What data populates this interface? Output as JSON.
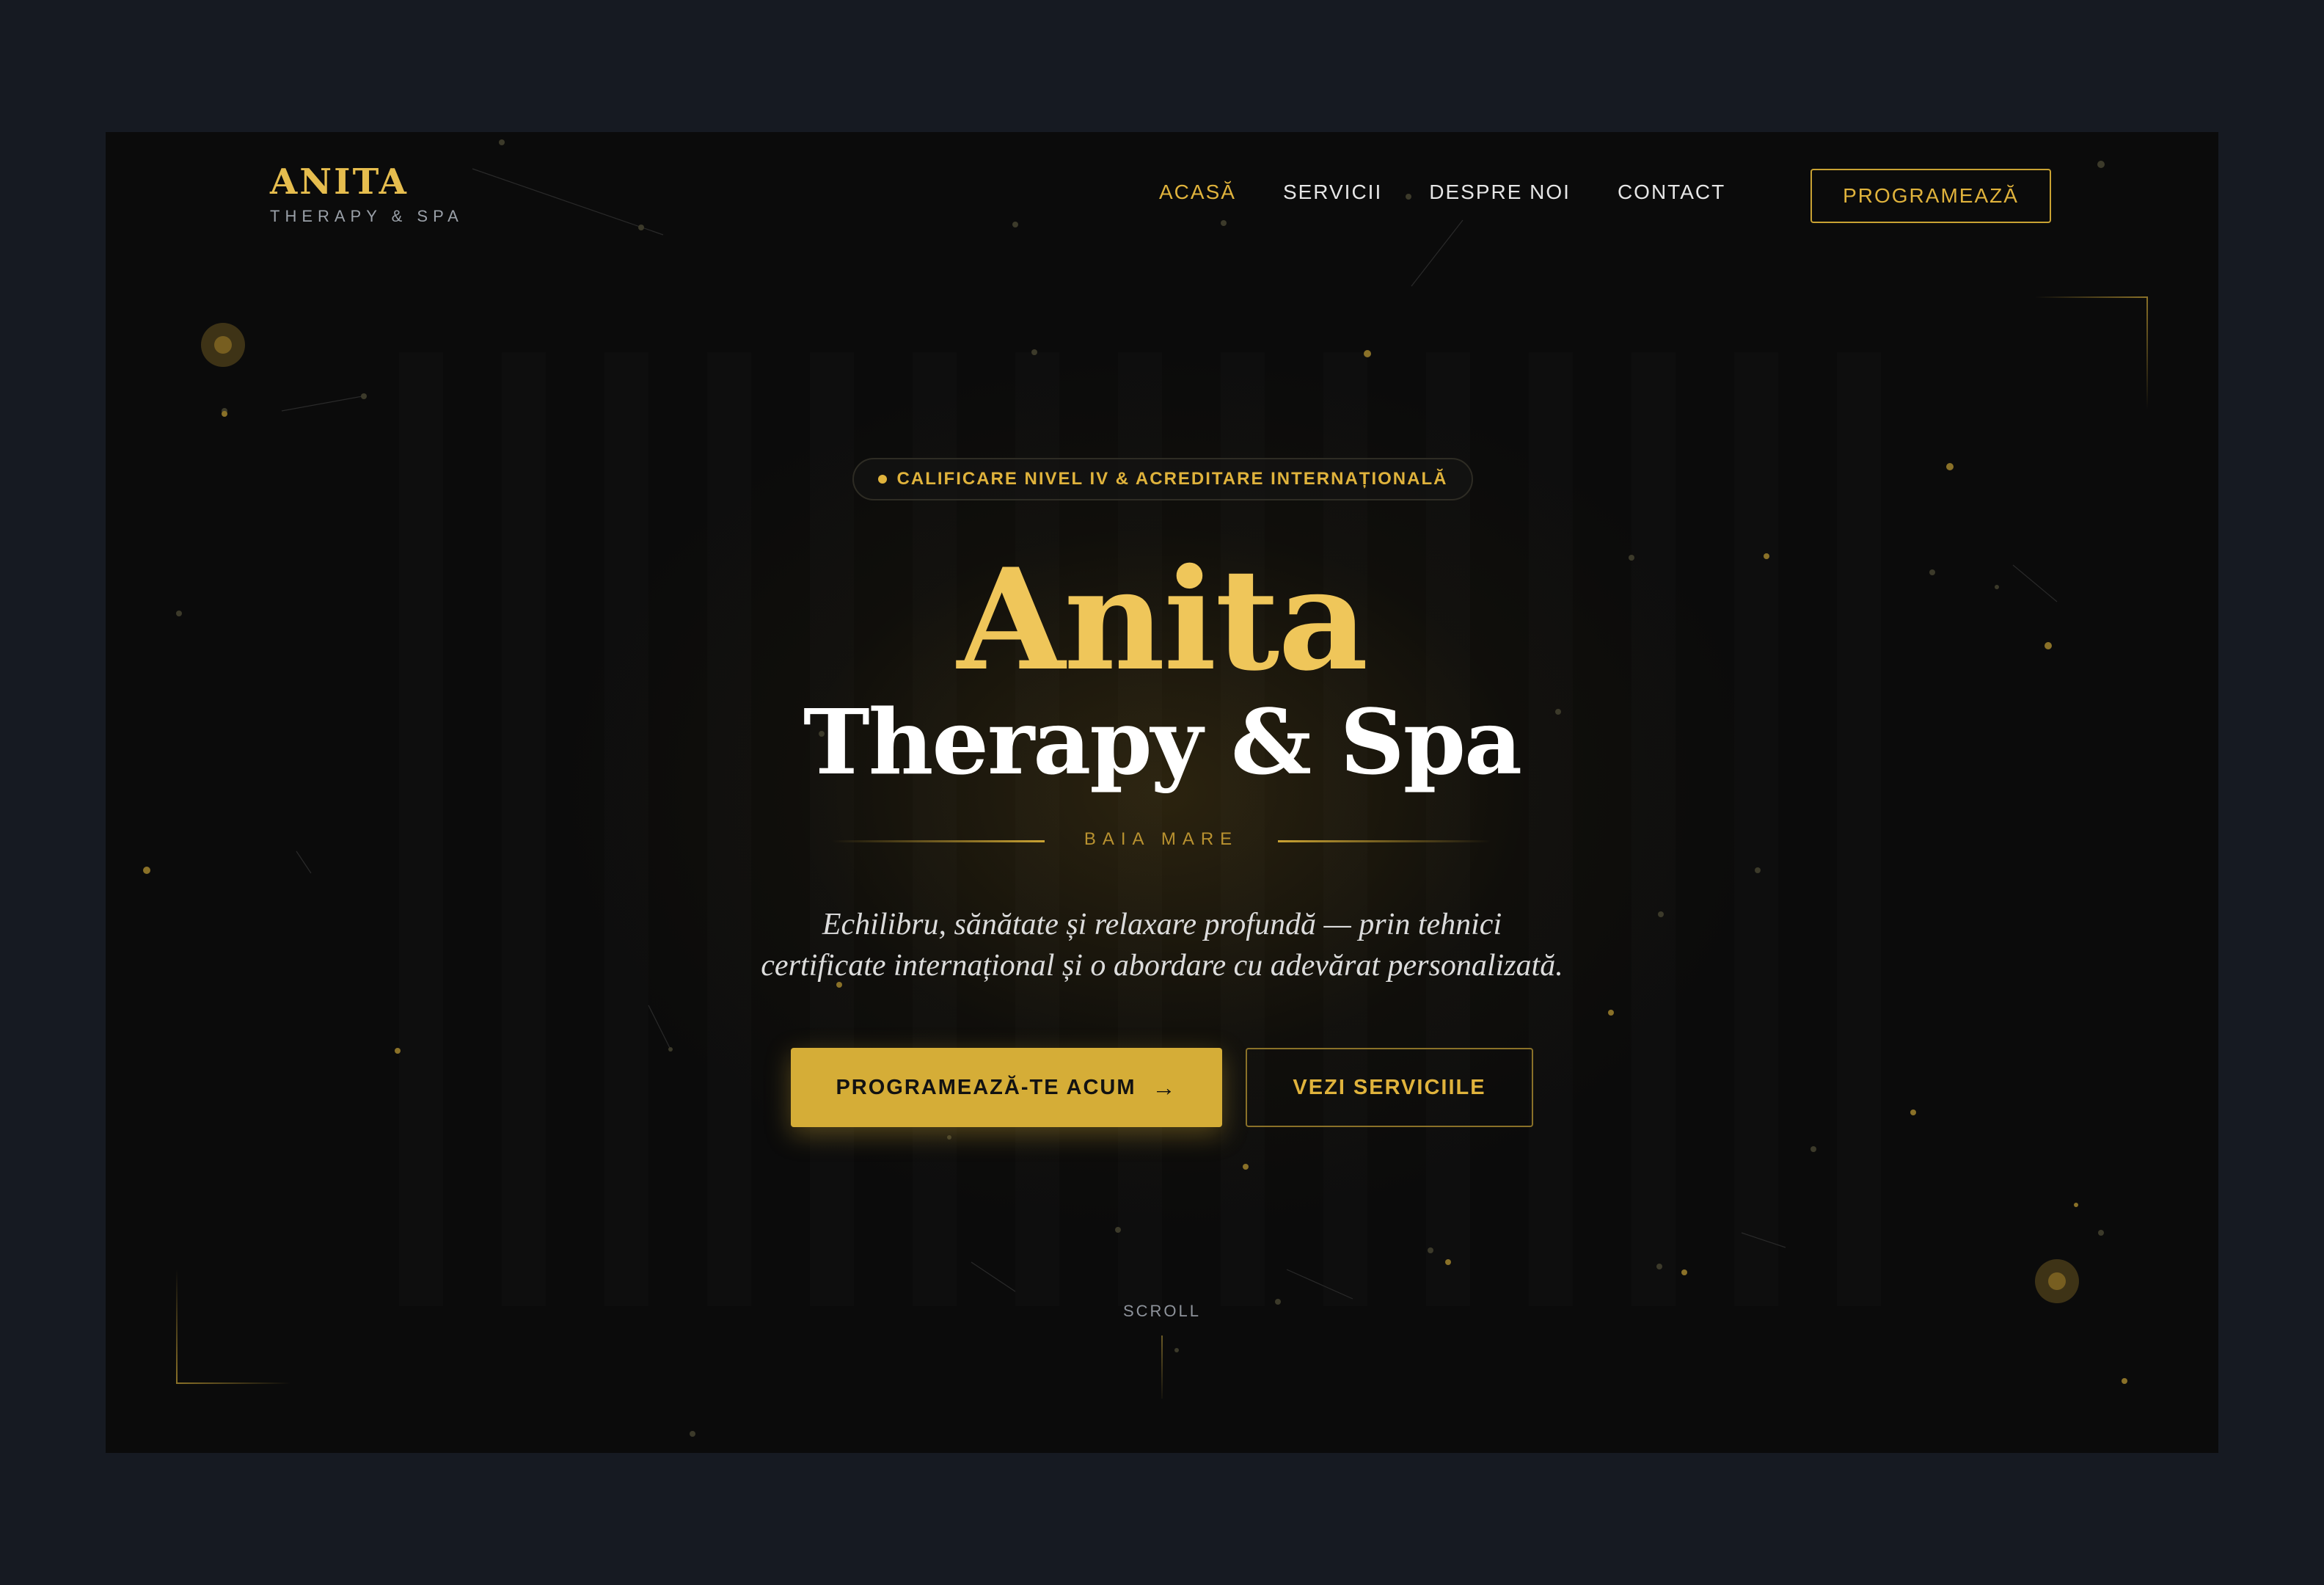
{
  "header": {
    "logo_title": "ANITA",
    "logo_subtitle": "THERAPY & SPA",
    "nav": [
      {
        "label": "ACASĂ",
        "active": true
      },
      {
        "label": "SERVICII",
        "active": false
      },
      {
        "label": "DESPRE NOI",
        "active": false
      },
      {
        "label": "CONTACT",
        "active": false
      }
    ],
    "cta_label": "PROGRAMEAZĂ"
  },
  "hero": {
    "badge_text": "CALIFICARE NIVEL IV & ACREDITARE INTERNAȚIONALĂ",
    "name": "Anita",
    "subtitle": "Therapy & Spa",
    "location": "BAIA MARE",
    "tagline": "Echilibru, sănătate și relaxare profundă — prin tehnici certificate internațional și o abordare cu adevărat personalizată.",
    "primary_button": "PROGRAMEAZĂ-TE ACUM",
    "primary_button_icon": "arrow-right-icon",
    "secondary_button": "VEZI SERVICIILE",
    "scroll_label": "SCROLL"
  },
  "colors": {
    "gold": "#e0b33c",
    "gold_button": "#d5ad37",
    "background": "#0b0b0b",
    "outer_background": "#161a22",
    "text_light": "#ffffff"
  }
}
